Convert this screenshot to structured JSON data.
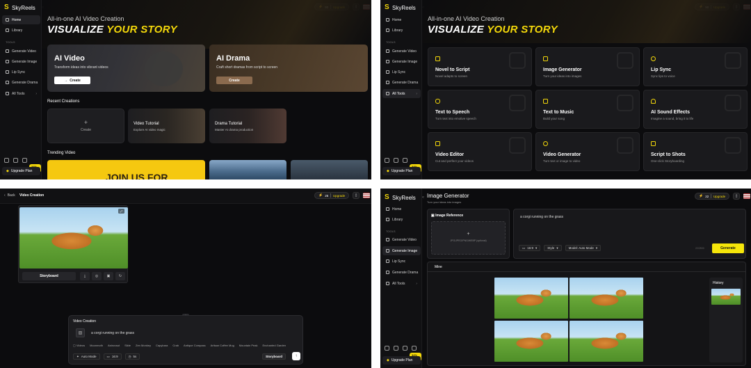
{
  "common": {
    "brand": "SkyReels",
    "nav": [
      "Home",
      "Library",
      "Generate Video",
      "Generate Image",
      "Lip Sync",
      "Generate Drama",
      "All Tools"
    ],
    "tools_label": "TOOLS",
    "upgrade_plan": "Upgrade Plan",
    "off_badge": "34% Off",
    "upgrade": "Upgrade"
  },
  "panel1": {
    "credits": "90",
    "hero_sub": "All-in-one AI Video Creation",
    "hero_title_a": "VISUALIZE ",
    "hero_title_b": "YOUR STORY",
    "card_ai_video": {
      "title": "AI Video",
      "desc": "Transform ideas into vibrant videos",
      "button": "Create"
    },
    "card_ai_drama": {
      "title": "AI Drama",
      "desc": "Craft short dramas from script to screen",
      "button": "Create"
    },
    "recent_title": "Recent Creations",
    "recent": [
      {
        "title": "Create",
        "desc": ""
      },
      {
        "title": "Video Tutorial",
        "desc": "Explore AI video magic"
      },
      {
        "title": "Drama Tutorial",
        "desc": "Master AI drama production"
      }
    ],
    "trending_title": "Trending Video",
    "trending_banner": "JOIN US FOR"
  },
  "panel2": {
    "credits": "90",
    "hero_sub": "All-in-one AI Video Creation",
    "hero_title_a": "VISUALIZE ",
    "hero_title_b": "YOUR STORY",
    "tools": [
      {
        "name": "Novel to Script",
        "desc": "Novel adapts to screen"
      },
      {
        "name": "Image Generator",
        "desc": "Turn your ideas into images"
      },
      {
        "name": "Lip Sync",
        "desc": "Sync lips to voice"
      },
      {
        "name": "Text to Speech",
        "desc": "Turn text into emotive speech"
      },
      {
        "name": "Text to Music",
        "desc": "Build your song"
      },
      {
        "name": "AI Sound Effects",
        "desc": "Imagine a sound, bring it to life"
      },
      {
        "name": "Video Editor",
        "desc": "Cut and perfect your videos"
      },
      {
        "name": "Video Generator",
        "desc": "Turn text or image to video"
      },
      {
        "name": "Script to Shots",
        "desc": "One-click Storyboarding"
      }
    ]
  },
  "panel3": {
    "back": "Back",
    "title": "Video Creation",
    "credits": "25",
    "storyboard_btn": "Storyboard",
    "composer_title": "Video Creation",
    "prompt": "a corgi running on the grass",
    "styles_label": "Videos",
    "styles": [
      "Moonmoth",
      "Astronaut",
      "Slide",
      "Zen Monkey",
      "Capybara",
      "Crab",
      "Antique Compass",
      "Artisan Coffee Mug",
      "Mountain Peak",
      "Enchanted Garden"
    ],
    "mode": "Auto Mode",
    "ratio": "16:9",
    "duration": "5s",
    "submit_mode": "Storyboard"
  },
  "panel4": {
    "title": "Image Generator",
    "subtitle": "Turn your ideas into images",
    "credits": "22",
    "ref_title": "Image Reference",
    "ref_hint": "JPG/JPEG/PNG/WEBP (optional)",
    "prompt": "a corgi running on the grass",
    "ratio": "16:9",
    "style": "Style",
    "model": "Model: Auto Mode",
    "counter": "22/2500",
    "generate": "Generate",
    "mine_tab": "Mine",
    "history": "History"
  }
}
